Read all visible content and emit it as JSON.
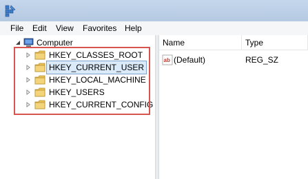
{
  "menu": {
    "file": "File",
    "edit": "Edit",
    "view": "View",
    "favorites": "Favorites",
    "help": "Help"
  },
  "tree": {
    "root": "Computer",
    "items": [
      {
        "label": "HKEY_CLASSES_ROOT"
      },
      {
        "label": "HKEY_CURRENT_USER",
        "selected": true
      },
      {
        "label": "HKEY_LOCAL_MACHINE"
      },
      {
        "label": "HKEY_USERS"
      },
      {
        "label": "HKEY_CURRENT_CONFIG"
      }
    ]
  },
  "list": {
    "columns": {
      "name": "Name",
      "type": "Type"
    },
    "rows": [
      {
        "icon": "ab",
        "name": "(Default)",
        "type": "REG_SZ"
      }
    ]
  },
  "colors": {
    "highlight_border": "#d9534f",
    "selection_bg": "#dbeaf9",
    "selection_border": "#7da2ce"
  }
}
